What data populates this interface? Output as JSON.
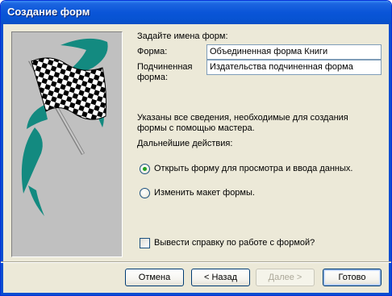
{
  "window": {
    "title": "Создание форм"
  },
  "instructions": "Задайте имена форм:",
  "fields": {
    "form_label": "Форма:",
    "form_value": "Объединенная форма Книги",
    "subform_label_line1": "Подчиненная",
    "subform_label_line2": "форма:",
    "subform_value": "Издательства подчиненная форма"
  },
  "info": {
    "line1": "Указаны все сведения, необходимые для создания",
    "line2": "формы с помощью мастера.",
    "next_actions": "Дальнейшие действия:"
  },
  "options": {
    "open_form": "Открыть форму для просмотра и ввода данных.",
    "modify_layout": "Изменить макет формы.",
    "selected": "open_form"
  },
  "help_checkbox": {
    "label": "Вывести справку по работе с формой?",
    "checked": false
  },
  "buttons": {
    "cancel": "Отмена",
    "back": "< Назад",
    "next": "Далее >",
    "finish": "Готово"
  },
  "icons": {
    "picture": "checkered-flag-icon"
  },
  "colors": {
    "titlebar": "#0a55d8",
    "dialog_bg": "#ece9d8",
    "flag_swoosh": "#138a80"
  }
}
